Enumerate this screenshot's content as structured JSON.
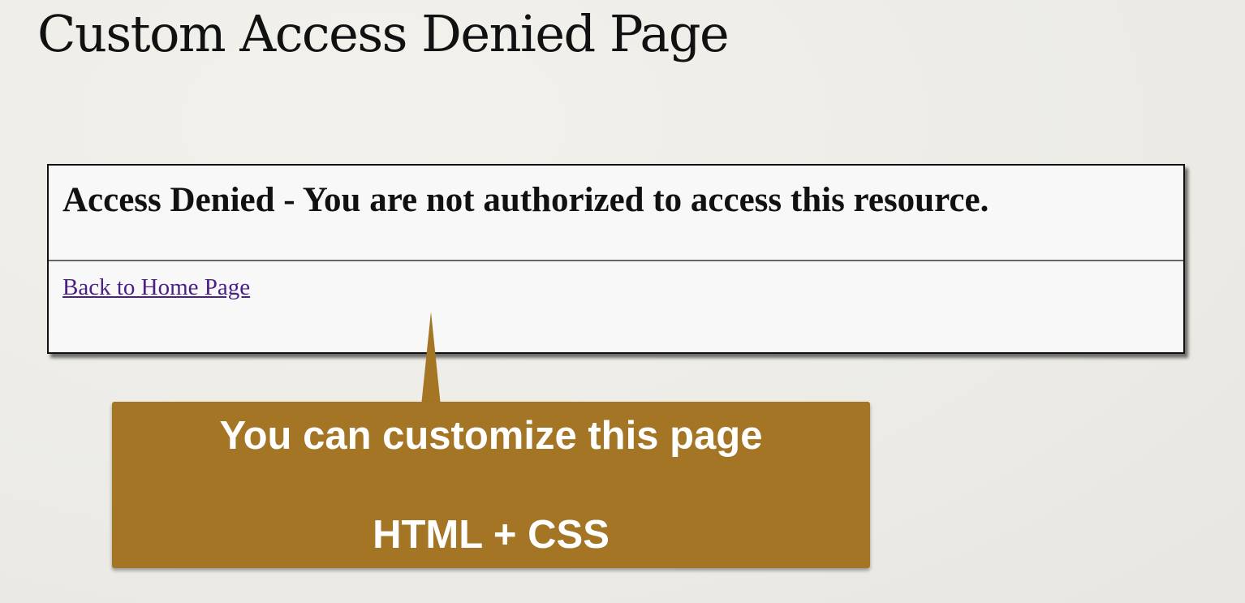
{
  "slide": {
    "title": "Custom Access Denied Page"
  },
  "browser_panel": {
    "heading": "Access Denied - You are not authorized to access this resource.",
    "link_label": "Back to Home Page",
    "link_color": "#4b1f86"
  },
  "callout": {
    "line1": "You can customize this page",
    "line2": "HTML + CSS",
    "background_color": "#a37525",
    "text_color": "#ffffff"
  }
}
